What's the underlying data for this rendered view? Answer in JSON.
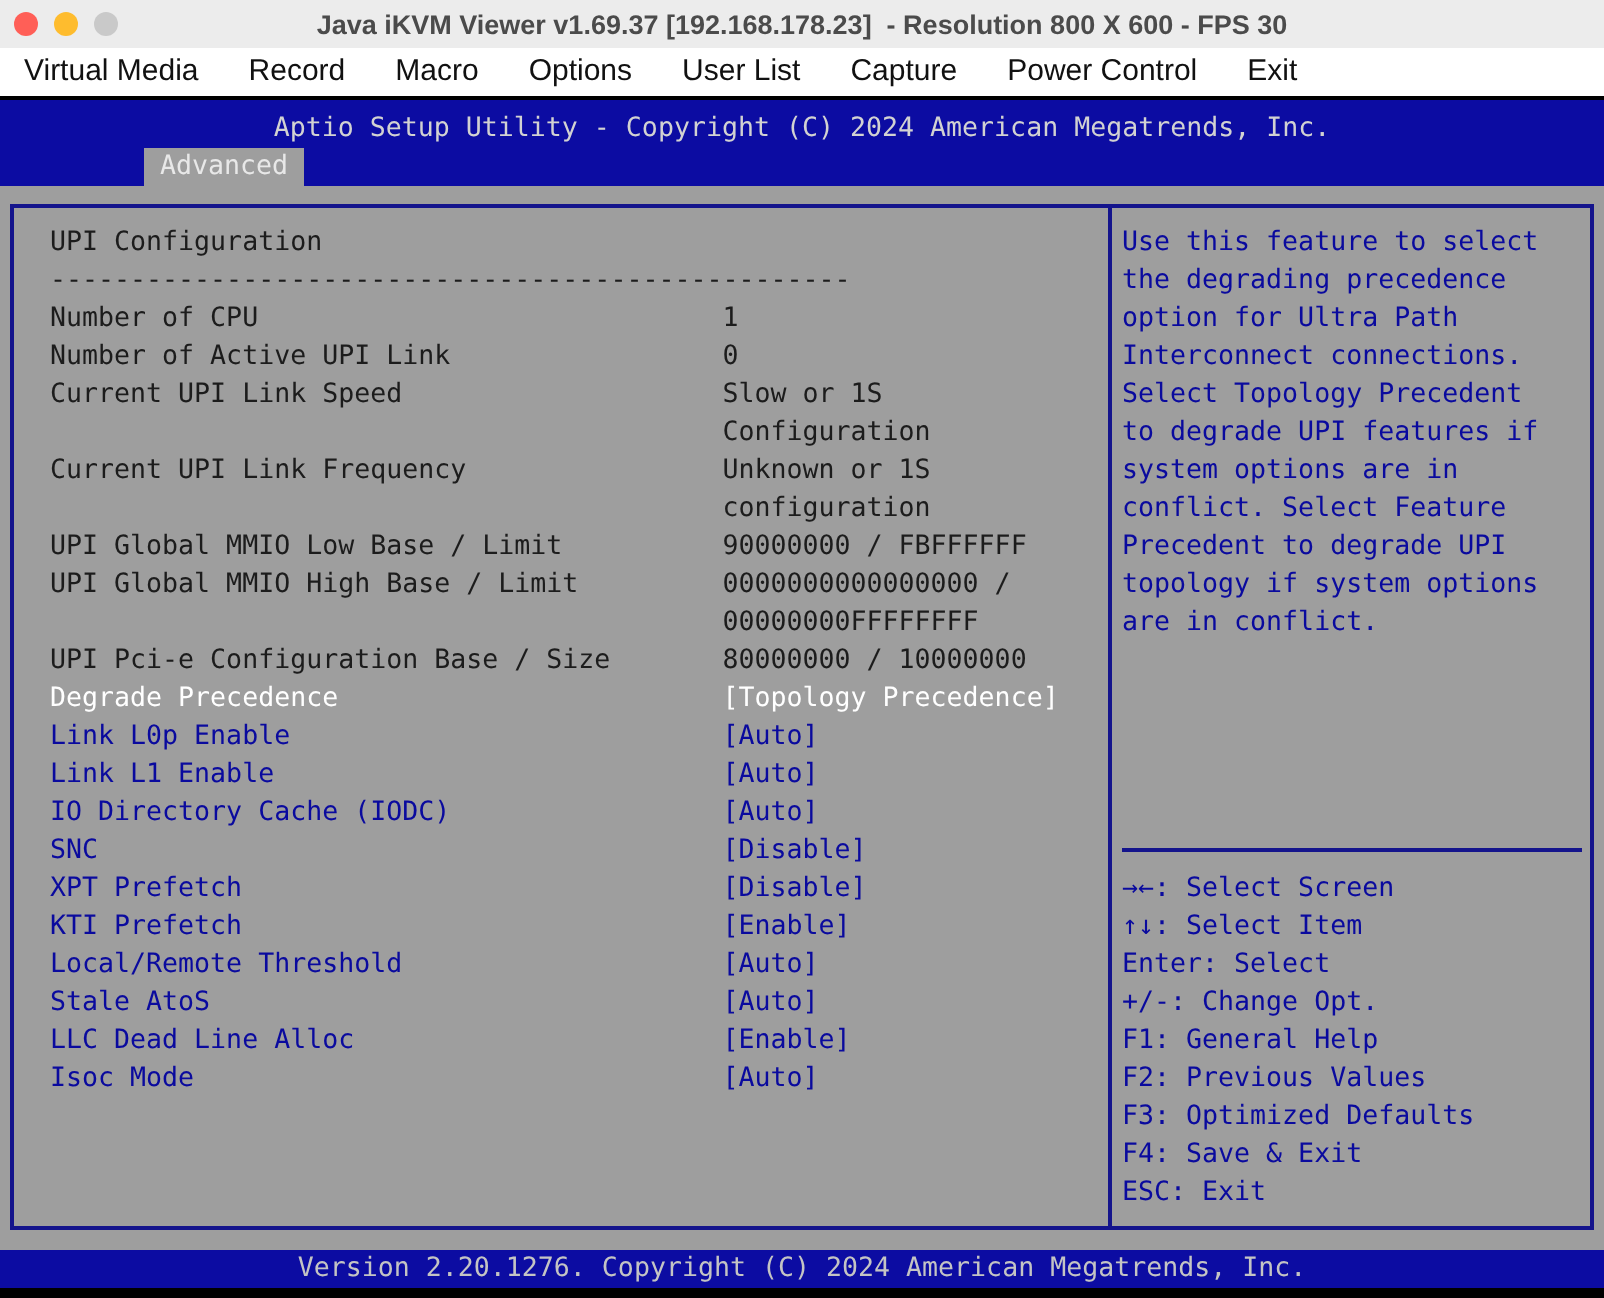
{
  "window": {
    "title": "Java iKVM Viewer v1.69.37 [192.168.178.23]  - Resolution 800 X 600 - FPS 30"
  },
  "menu_bar": [
    "Virtual Media",
    "Record",
    "Macro",
    "Options",
    "User List",
    "Capture",
    "Power Control",
    "Exit"
  ],
  "bios": {
    "header": "Aptio Setup Utility - Copyright (C) 2024 American Megatrends, Inc.",
    "tabs": [
      {
        "label": "Advanced",
        "selected": true
      }
    ],
    "section_title": "UPI Configuration",
    "separator": "--------------------------------------------------",
    "items": [
      {
        "kind": "info",
        "label": "Number of CPU",
        "value": "1",
        "selected": false
      },
      {
        "kind": "info",
        "label": "Number of Active UPI Link",
        "value": "0",
        "selected": false
      },
      {
        "kind": "info",
        "label": "Current UPI Link Speed",
        "value": "Slow or 1S Configuration",
        "selected": false
      },
      {
        "kind": "info",
        "label": "Current UPI Link Frequency",
        "value": "Unknown or 1S configuration",
        "selected": false
      },
      {
        "kind": "info",
        "label": "UPI Global MMIO Low Base / Limit",
        "value": "90000000 / FBFFFFFF",
        "selected": false
      },
      {
        "kind": "info",
        "label": "UPI Global MMIO High Base / Limit",
        "value": "0000000000000000 / 00000000FFFFFFFF",
        "selected": false
      },
      {
        "kind": "info",
        "label": "UPI Pci-e Configuration Base / Size",
        "value": "80000000 / 10000000",
        "selected": false
      },
      {
        "kind": "setting",
        "label": "Degrade Precedence",
        "value": "[Topology Precedence]",
        "selected": true
      },
      {
        "kind": "setting",
        "label": "Link L0p Enable",
        "value": "[Auto]",
        "selected": false
      },
      {
        "kind": "setting",
        "label": "Link L1 Enable",
        "value": "[Auto]",
        "selected": false
      },
      {
        "kind": "setting",
        "label": "IO Directory Cache (IODC)",
        "value": "[Auto]",
        "selected": false
      },
      {
        "kind": "setting",
        "label": "SNC",
        "value": "[Disable]",
        "selected": false
      },
      {
        "kind": "setting",
        "label": "XPT Prefetch",
        "value": "[Disable]",
        "selected": false
      },
      {
        "kind": "setting",
        "label": "KTI Prefetch",
        "value": "[Enable]",
        "selected": false
      },
      {
        "kind": "setting",
        "label": "Local/Remote Threshold",
        "value": "[Auto]",
        "selected": false
      },
      {
        "kind": "setting",
        "label": "Stale AtoS",
        "value": "[Auto]",
        "selected": false
      },
      {
        "kind": "setting",
        "label": "LLC Dead Line Alloc",
        "value": "[Enable]",
        "selected": false
      },
      {
        "kind": "setting",
        "label": "Isoc Mode",
        "value": "[Auto]",
        "selected": false
      }
    ],
    "help_text": "Use this feature to select the degrading precedence option for Ultra Path Interconnect connections. Select Topology Precedent to degrade UPI features if system options are in conflict. Select Feature Precedent to degrade UPI topology if system options are in conflict.",
    "key_legend": [
      "→←: Select Screen",
      "↑↓: Select Item",
      "Enter: Select",
      "+/-: Change Opt.",
      "F1: General Help",
      "F2: Previous Values",
      "F3: Optimized Defaults",
      "F4: Save & Exit",
      "ESC: Exit"
    ],
    "footer": "Version 2.20.1276. Copyright (C) 2024 American Megatrends, Inc."
  }
}
